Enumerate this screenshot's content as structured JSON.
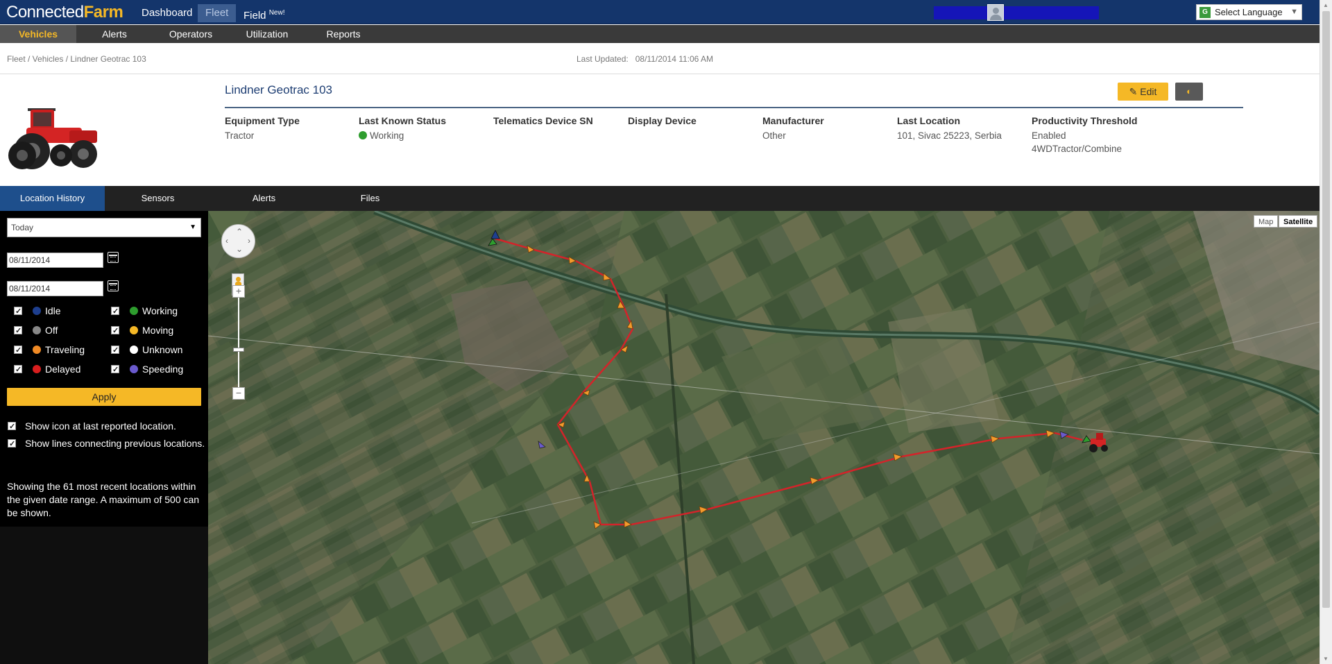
{
  "brand": {
    "name_a": "Connected",
    "name_b": "Farm"
  },
  "topnav": {
    "dashboard": "Dashboard",
    "fleet": "Fleet",
    "field": "Field",
    "field_badge": "New!"
  },
  "language": {
    "label": "Select Language",
    "icon": "google-translate-icon"
  },
  "subnav": [
    "Vehicles",
    "Alerts",
    "Operators",
    "Utilization",
    "Reports"
  ],
  "breadcrumb": "Fleet / Vehicles / Lindner Geotrac 103",
  "last_updated": {
    "label": "Last Updated:",
    "value": "08/11/2014 11:06 AM"
  },
  "vehicle": {
    "title": "Lindner Geotrac 103",
    "edit_label": "Edit",
    "details": [
      {
        "label": "Equipment Type",
        "value": "Tractor"
      },
      {
        "label": "Last Known Status",
        "value": "Working"
      },
      {
        "label": "Telematics Device SN",
        "value": ""
      },
      {
        "label": "Display Device",
        "value": ""
      },
      {
        "label": "Manufacturer",
        "value": "Other"
      },
      {
        "label": "Last Location",
        "value": "101, Sivac 25223, Serbia"
      },
      {
        "label": "Productivity Threshold",
        "value": "Enabled",
        "value2": "4WDTractor/Combine"
      }
    ]
  },
  "section_tabs": [
    "Location History",
    "Sensors",
    "Alerts",
    "Files"
  ],
  "sidebar": {
    "range_select": "Today",
    "date_from": "08/11/2014",
    "date_to": "08/11/2014",
    "legend": [
      {
        "label": "Idle",
        "color": "#1e3f8f"
      },
      {
        "label": "Working",
        "color": "#2e9d2e"
      },
      {
        "label": "Off",
        "color": "#888888"
      },
      {
        "label": "Moving",
        "color": "#f5b826"
      },
      {
        "label": "Traveling",
        "color": "#f08a25"
      },
      {
        "label": "Unknown",
        "color": "#ffffff"
      },
      {
        "label": "Delayed",
        "color": "#d81e1e"
      },
      {
        "label": "Speeding",
        "color": "#6a5acd"
      }
    ],
    "apply_label": "Apply",
    "option_icon": "Show icon at last reported location.",
    "option_lines": "Show lines connecting previous locations.",
    "showing_text": "Showing the 61 most recent locations within the given date range. A maximum of 500 can be shown."
  },
  "map": {
    "type_map": "Map",
    "type_satellite": "Satellite",
    "zoom_in": "+",
    "zoom_out": "−"
  }
}
